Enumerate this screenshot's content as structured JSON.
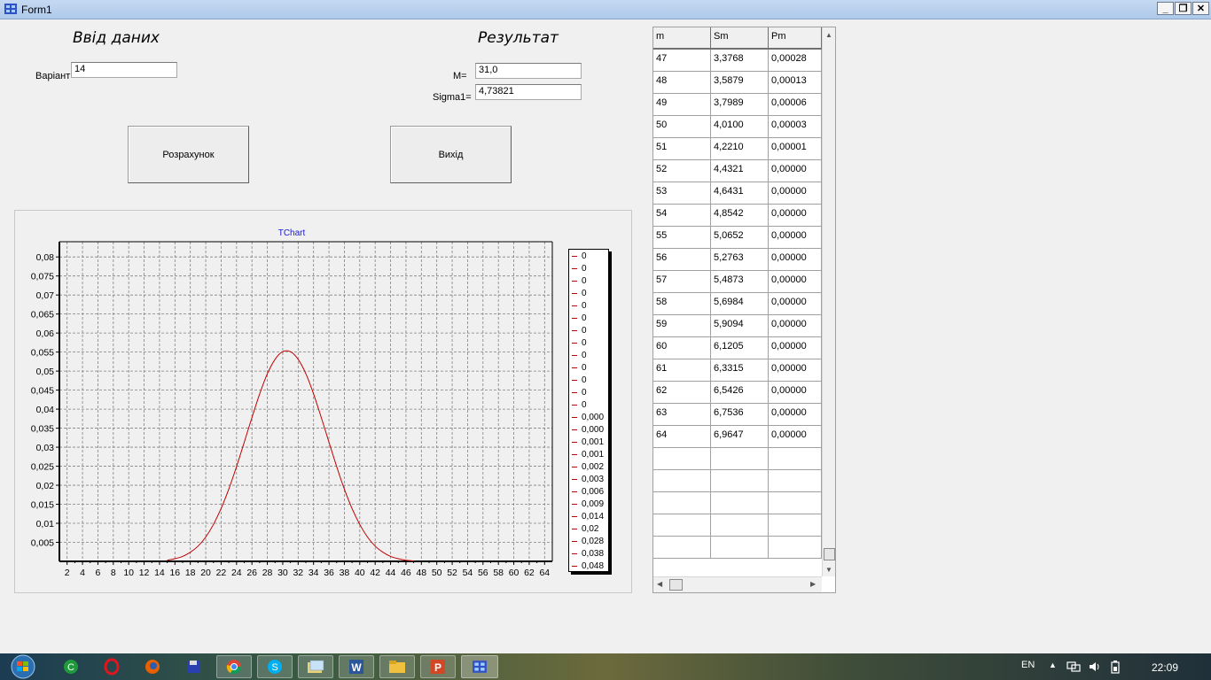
{
  "window": {
    "title": "Form1"
  },
  "input_section": {
    "heading": "Ввід даних",
    "variant_label": "Варіант",
    "variant_value": "14"
  },
  "result_section": {
    "heading": "Результат",
    "m_label": "M=",
    "m_value": "31,0",
    "sigma_label": "Sigma1=",
    "sigma_value": "4,73821"
  },
  "buttons": {
    "calculate": "Розрахунок",
    "exit": "Вихід"
  },
  "chart_data": {
    "type": "line",
    "title": "TChart",
    "x_ticks": [
      2,
      4,
      6,
      8,
      10,
      12,
      14,
      16,
      18,
      20,
      22,
      24,
      26,
      28,
      30,
      32,
      34,
      36,
      38,
      40,
      42,
      44,
      46,
      48,
      50,
      52,
      54,
      56,
      58,
      60,
      62,
      64
    ],
    "y_tick_labels": [
      "0,08",
      "0,075",
      "0,07",
      "0,065",
      "0,06",
      "0,055",
      "0,05",
      "0,045",
      "0,04",
      "0,035",
      "0,03",
      "0,025",
      "0,02",
      "0,015",
      "0,01",
      "0,005"
    ],
    "y_ticks": [
      0.08,
      0.075,
      0.07,
      0.065,
      0.06,
      0.055,
      0.05,
      0.045,
      0.04,
      0.035,
      0.03,
      0.025,
      0.02,
      0.015,
      0.01,
      0.005
    ],
    "xlim": [
      1,
      65
    ],
    "ylim": [
      0,
      0.084
    ],
    "grid": true,
    "legend_position": "right",
    "series": [
      {
        "color": "#c00000",
        "x": [
          15,
          16,
          17,
          18,
          19,
          20,
          21,
          22,
          23,
          24,
          25,
          26,
          27,
          28,
          29,
          30,
          31,
          32,
          33,
          34,
          35,
          36,
          37,
          38,
          39,
          40,
          41,
          42,
          43,
          44,
          45,
          46,
          47
        ],
        "y": [
          0.0003,
          0.0007,
          0.0013,
          0.0024,
          0.004,
          0.0064,
          0.0097,
          0.0139,
          0.019,
          0.0249,
          0.0313,
          0.0378,
          0.044,
          0.0493,
          0.0531,
          0.0551,
          0.0551,
          0.0531,
          0.0493,
          0.044,
          0.0378,
          0.0313,
          0.0249,
          0.019,
          0.0139,
          0.0097,
          0.0064,
          0.004,
          0.0024,
          0.0013,
          0.0007,
          0.0003,
          0.0001
        ]
      }
    ],
    "legend_entries": [
      "0",
      "0",
      "0",
      "0",
      "0",
      "0",
      "0",
      "0",
      "0",
      "0",
      "0",
      "0",
      "0",
      "0,000",
      "0,000",
      "0,001",
      "0,001",
      "0,002",
      "0,003",
      "0,006",
      "0,009",
      "0,014",
      "0,02",
      "0,028",
      "0,038",
      "0,048"
    ]
  },
  "table": {
    "headers": [
      "m",
      "Sm",
      "Pm"
    ],
    "rows": [
      [
        "47",
        "3,3768",
        "0,00028"
      ],
      [
        "48",
        "3,5879",
        "0,00013"
      ],
      [
        "49",
        "3,7989",
        "0,00006"
      ],
      [
        "50",
        "4,0100",
        "0,00003"
      ],
      [
        "51",
        "4,2210",
        "0,00001"
      ],
      [
        "52",
        "4,4321",
        "0,00000"
      ],
      [
        "53",
        "4,6431",
        "0,00000"
      ],
      [
        "54",
        "4,8542",
        "0,00000"
      ],
      [
        "55",
        "5,0652",
        "0,00000"
      ],
      [
        "56",
        "5,2763",
        "0,00000"
      ],
      [
        "57",
        "5,4873",
        "0,00000"
      ],
      [
        "58",
        "5,6984",
        "0,00000"
      ],
      [
        "59",
        "5,9094",
        "0,00000"
      ],
      [
        "60",
        "6,1205",
        "0,00000"
      ],
      [
        "61",
        "6,3315",
        "0,00000"
      ],
      [
        "62",
        "6,5426",
        "0,00000"
      ],
      [
        "63",
        "6,7536",
        "0,00000"
      ],
      [
        "64",
        "6,9647",
        "0,00000"
      ],
      [
        "",
        "",
        ""
      ],
      [
        "",
        "",
        ""
      ],
      [
        "",
        "",
        ""
      ],
      [
        "",
        "",
        ""
      ],
      [
        "",
        "",
        ""
      ]
    ]
  },
  "taskbar": {
    "start_icon": "windows-orb-icon",
    "apps": [
      "ccleaner-icon",
      "opera-icon",
      "firefox-icon",
      "save-disk-icon",
      "chrome-icon",
      "skype-icon",
      "folder-pictures-icon",
      "word-icon",
      "explorer-icon",
      "powerpoint-icon",
      "delphi-app-icon"
    ],
    "language": "EN",
    "time": "22:09"
  }
}
